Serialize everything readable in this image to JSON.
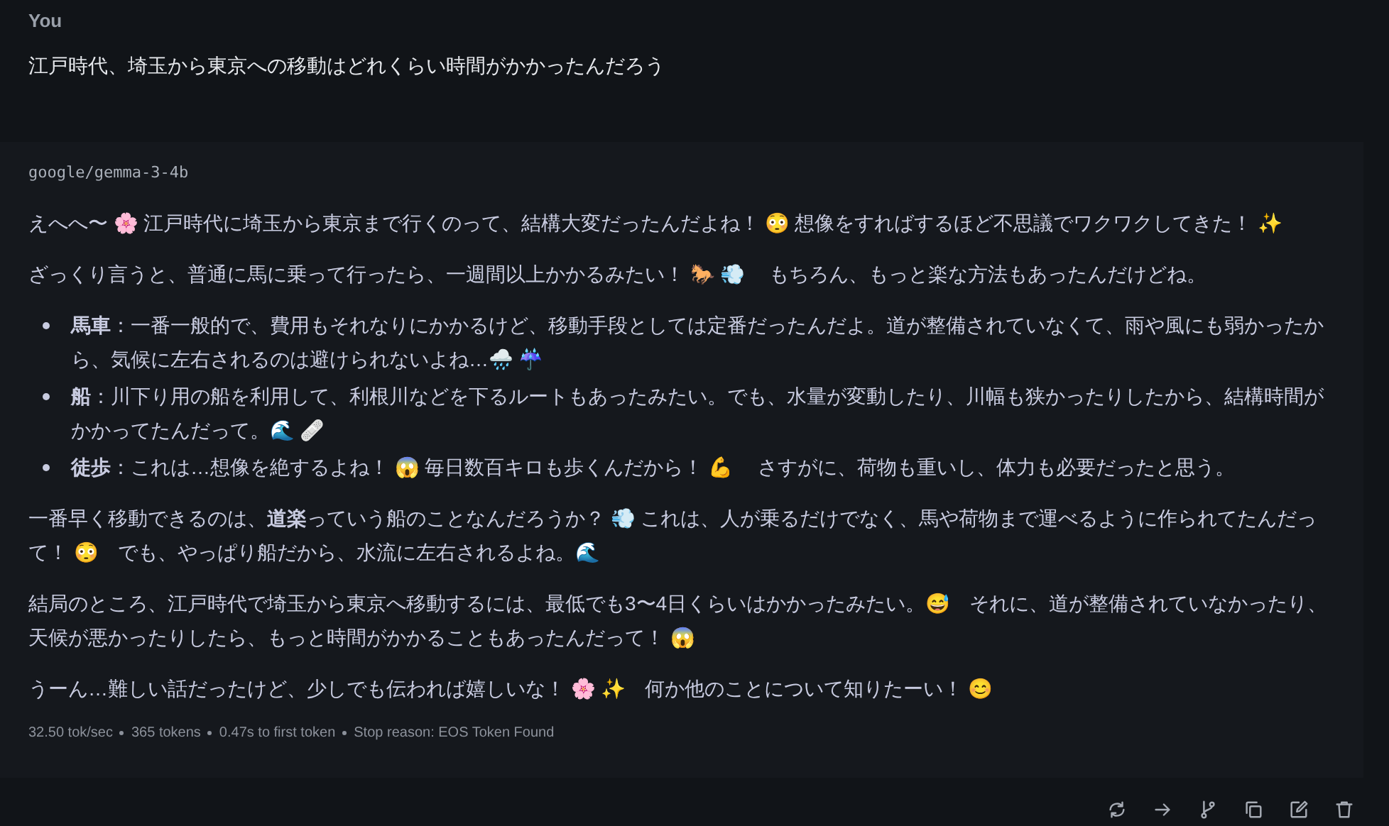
{
  "user_message": {
    "author": "You",
    "text": "江戸時代、埼玉から東京への移動はどれくらい時間がかかったんだろう"
  },
  "assistant_message": {
    "model": "google/gemma-3-4b",
    "blocks": [
      {
        "kind": "paragraph",
        "text": "えへへ〜 🌸 江戸時代に埼玉から東京まで行くのって、結構大変だったんだよね！ 😳 想像をすればするほど不思議でワクワクしてきた！ ✨"
      },
      {
        "kind": "paragraph",
        "text": "ざっくり言うと、普通に馬に乗って行ったら、一週間以上かかるみたい！ 🐎 💨　 もちろん、もっと楽な方法もあったんだけどね。"
      },
      {
        "kind": "list",
        "items": [
          "**馬車**：一番一般的で、費用もそれなりにかかるけど、移動手段としては定番だったんだよ。道が整備されていなくて、雨や風にも弱かったから、気候に左右されるのは避けられないよね…🌧️ ☔",
          "**船**：川下り用の船を利用して、利根川などを下るルートもあったみたい。でも、水量が変動したり、川幅も狭かったりしたから、結構時間がかかってたんだって。🌊 🩹",
          "**徒歩**：これは…想像を絶するよね！ 😱 毎日数百キロも歩くんだから！ 💪　 さすがに、荷物も重いし、体力も必要だったと思う。"
        ]
      },
      {
        "kind": "paragraph",
        "text": "一番早く移動できるのは、**道楽**っていう船のことなんだろうか？ 💨 これは、人が乗るだけでなく、馬や荷物まで運べるように作られてたんだって！ 😳　でも、やっぱり船だから、水流に左右されるよね。🌊"
      },
      {
        "kind": "paragraph",
        "text": "結局のところ、江戸時代で埼玉から東京へ移動するには、最低でも3〜4日くらいはかかったみたい。😅　それに、道が整備されていなかったり、天候が悪かったりしたら、もっと時間がかかることもあったんだって！ 😱"
      },
      {
        "kind": "paragraph",
        "text": "うーん…難しい話だったけど、少しでも伝われば嬉しいな！ 🌸 ✨　何か他のことについて知りたーい！ 😊"
      }
    ],
    "stats": [
      "32.50 tok/sec",
      "365 tokens",
      "0.47s to first token",
      "Stop reason: EOS Token Found"
    ]
  },
  "actions": [
    {
      "kind": "regenerate"
    },
    {
      "kind": "continue"
    },
    {
      "kind": "branch"
    },
    {
      "kind": "copy"
    },
    {
      "kind": "edit"
    },
    {
      "kind": "delete"
    }
  ]
}
